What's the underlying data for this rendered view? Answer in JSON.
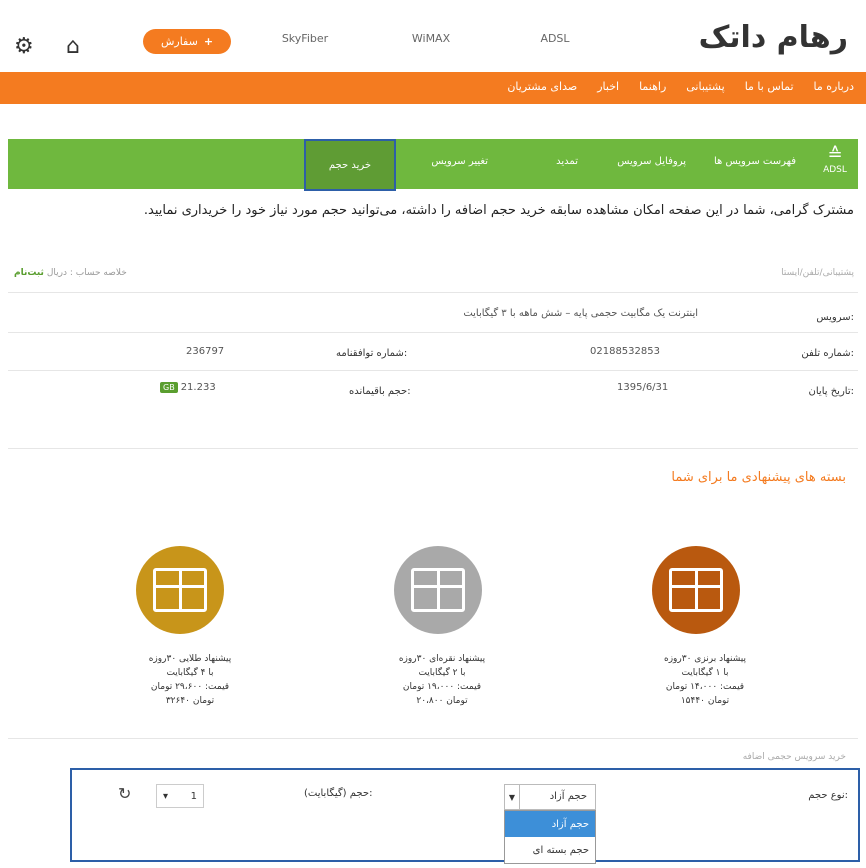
{
  "header": {
    "logo": "رهام داتک",
    "order_button": "سفارش",
    "tabs": [
      "SkyFiber",
      "WiMAX",
      "ADSL"
    ]
  },
  "orange_menu": [
    "درباره ما",
    "تماس با ما",
    "پشتیبانی",
    "راهنما",
    "اخبار",
    "صدای مشتریان"
  ],
  "green_menu": {
    "icon_label": "ADSL",
    "items": [
      "فهرست سرویس ها",
      "پروفایل سرویس",
      "تمدید",
      "تغییر سرویس"
    ],
    "active": "خرید حجم"
  },
  "intro_text": "مشترک گرامی، شما در این صفحه امکان مشاهده سابقه خرید حجم اضافه را داشته، می‌توانید حجم مورد نیاز خود را خریداری نمایید.",
  "info": {
    "crumb_left_prefix": "خلاصه حساب : دریال",
    "crumb_left_emph": "ثبت‌نام",
    "crumb_right": "پشتیبانی/تلفن/ایستا",
    "service_label": "سرویس:",
    "service_value": "اینترنت یک مگابیت حجمی پایه – شش ماهه با ۳ گیگابایت",
    "phone_label": "شماره تلفن:",
    "phone_value": "02188532853",
    "contract_label": "شماره توافقنامه:",
    "contract_value": "236797",
    "end_label": "تاریخ پایان:",
    "end_value": "1395/6/31",
    "remain_label": "حجم باقیمانده:",
    "remain_value": "21.233",
    "remain_badge": "GB"
  },
  "suggest_title": "بسته های پیشنهادی ما برای شما",
  "packages": [
    {
      "color": "#c8951a",
      "l1": "پیشنهاد طلایی ۳۰روزه",
      "l2": "با ۴ گیگابایت",
      "l3": "قیمت: ۲۹،۶۰۰ تومان",
      "l4": "۳۲۶۴۰ تومان"
    },
    {
      "color": "#a9a9a9",
      "l1": "پیشنهاد نقره‌ای ۳۰روزه",
      "l2": "با ۲ گیگابایت",
      "l3": "قیمت: ۱۹،۰۰۰ تومان",
      "l4": "۲۰،۸۰۰ تومان"
    },
    {
      "color": "#b9590f",
      "l1": "پیشنهاد برنزی ۳۰روزه",
      "l2": "با ۱ گیگابایت",
      "l3": "قیمت: ۱۴،۰۰۰ تومان",
      "l4": "۱۵۴۴۰ تومان"
    }
  ],
  "purchase": {
    "section_title": "خرید سرویس حجمی اضافه",
    "type_label": "نوع حجم:",
    "selected": "حجم آزاد",
    "options": [
      "حجم آزاد",
      "حجم بسته ای"
    ],
    "volume_label": "حجم (گیگابایت):",
    "quantity": "1"
  },
  "colors": {
    "orange": "#f47b20",
    "green": "#6fb83e",
    "highlight": "#2d5fa8"
  }
}
